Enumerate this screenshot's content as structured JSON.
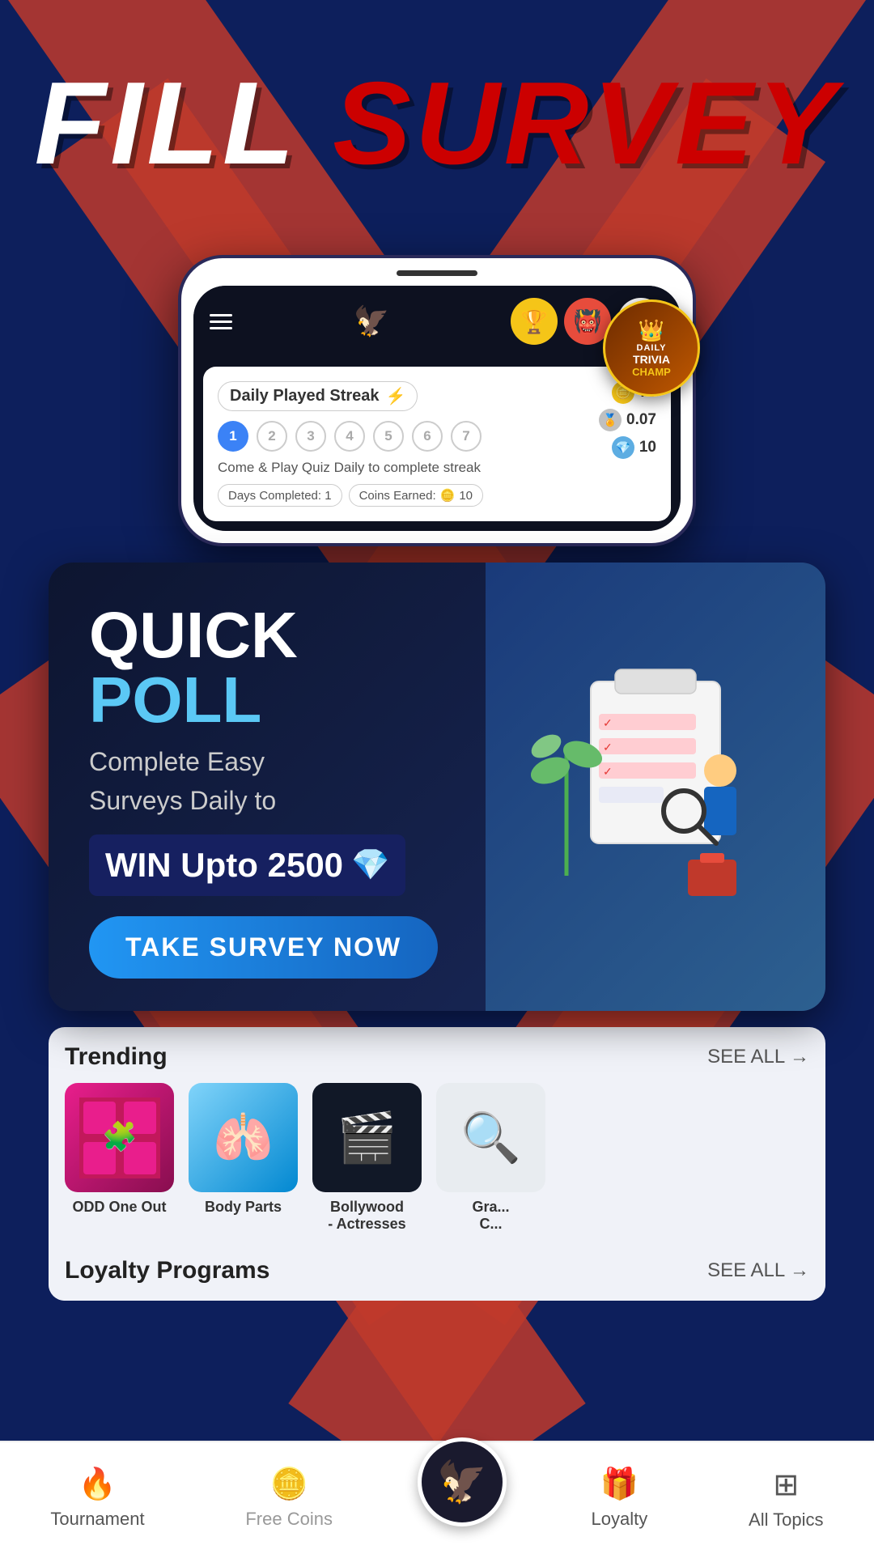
{
  "app": {
    "title": "Fill Survey",
    "title_color": "white",
    "title_highlight": "SURVEY",
    "background_color": "#0d1f5c",
    "accent_red": "#c0392b"
  },
  "phone": {
    "header": {
      "logo": "🦅",
      "buttons": [
        {
          "icon": "🏆",
          "bg": "#f5c518",
          "name": "trophy"
        },
        {
          "icon": "👹",
          "bg": "#e74c3c",
          "name": "monster"
        },
        {
          "icon": "🎯",
          "bg": "white",
          "name": "target"
        }
      ]
    },
    "streak": {
      "label": "Daily Played Streak",
      "emoji": "⚡",
      "description": "Come & Play Quiz Daily to complete streak",
      "days": [
        "1",
        "2",
        "3",
        "4",
        "5",
        "6",
        "7"
      ],
      "active_day": 1,
      "days_completed": "Days Completed: 1",
      "coins_earned": "Coins Earned:",
      "coins_value": "10",
      "stats": [
        {
          "value": "75",
          "icon": "🪙",
          "color": "#f5c518"
        },
        {
          "value": "0.07",
          "icon": "🏅",
          "color": "#c0c0c0"
        },
        {
          "value": "10",
          "icon": "💎",
          "color": "#5dade2"
        }
      ]
    }
  },
  "quick_poll": {
    "title": "QUICK",
    "title_highlight": "POLL",
    "subtitle_line1": "Complete Easy",
    "subtitle_line2": "Surveys Daily to",
    "win_text": "WIN Upto 2500",
    "win_icon": "💎",
    "cta_button": "TAKE SURVEY NOW"
  },
  "trending": {
    "title": "Trending",
    "see_all": "SEE ALL →",
    "items": [
      {
        "label": "ODD One Out",
        "emoji": "🧩",
        "color_class": "t-pink"
      },
      {
        "label": "Body Parts",
        "emoji": "🫁",
        "color_class": "t-body"
      },
      {
        "label": "Bollywood - Actresses",
        "emoji": "🎬",
        "color_class": "t-dark"
      },
      {
        "label": "Gra...",
        "emoji": "🔍",
        "color_class": "t-light"
      }
    ]
  },
  "loyalty": {
    "title": "Loyalty Programs",
    "see_all": "SEE ALL →"
  },
  "trivia_champ": {
    "crown": "👑",
    "daily": "DAILY",
    "trivia": "TRIVIA",
    "champ": "CHAMP"
  },
  "bottom_nav": {
    "items": [
      {
        "label": "Tournament",
        "icon": "🔥"
      },
      {
        "label": "Free Coins",
        "icon": "🪙"
      },
      {
        "label": "",
        "icon": "🦅",
        "center": true
      },
      {
        "label": "Loyalty",
        "icon": "🎁"
      },
      {
        "label": "All Topics",
        "icon": "⊞"
      }
    ]
  }
}
